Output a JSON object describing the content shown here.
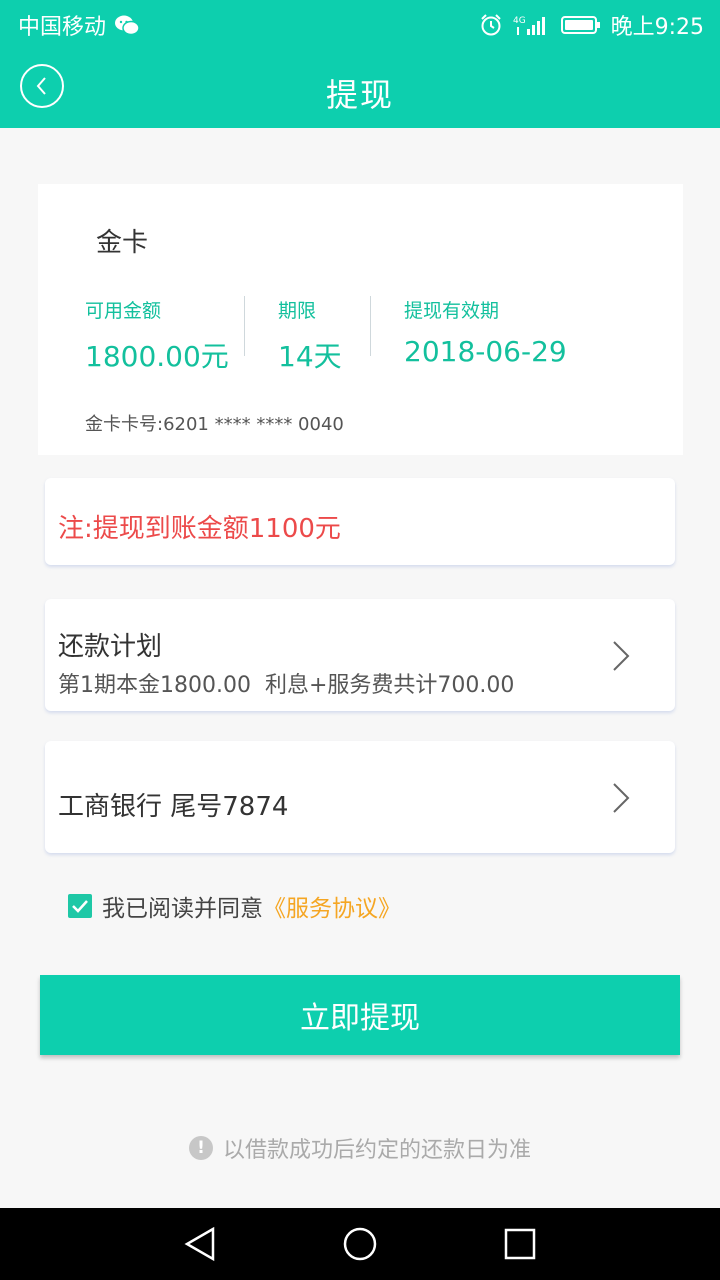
{
  "status_bar": {
    "carrier": "中国移动",
    "network": "4G",
    "time": "晚上9:25",
    "icons": [
      "wechat-icon",
      "alarm-icon",
      "signal-icon",
      "battery-icon"
    ]
  },
  "header": {
    "title": "提现",
    "back_icon": "chevron-left-icon"
  },
  "card": {
    "name": "金卡",
    "available_label": "可用金额",
    "available_value": "1800.00元",
    "term_label": "期限",
    "term_value": "14天",
    "validity_label": "提现有效期",
    "validity_value": "2018-06-29",
    "card_number": "金卡卡号:6201 **** **** 0040"
  },
  "note": {
    "text": "注:提现到账金额1100元"
  },
  "repayment": {
    "title": "还款计划",
    "detail": "第1期本金1800.00  利息+服务费共计700.00"
  },
  "bank": {
    "text": "工商银行 尾号7874"
  },
  "agreement": {
    "checked": true,
    "text": "我已阅读并同意",
    "link": "《服务协议》"
  },
  "submit": {
    "label": "立即提现"
  },
  "hint": {
    "text": "以借款成功后约定的还款日为准"
  },
  "colors": {
    "primary": "#0dcfae",
    "accent_text": "#13c09d",
    "warning": "#ec4a4a",
    "link": "#f5a623"
  },
  "system_nav": {
    "buttons": [
      "back-triangle-icon",
      "home-circle-icon",
      "recents-square-icon"
    ]
  }
}
